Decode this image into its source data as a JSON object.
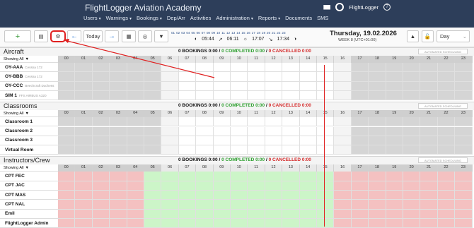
{
  "app": {
    "title": "FlightLogger Aviation Academy",
    "brand": "FlightLogger",
    "help_label": "?"
  },
  "nav": [
    "Users",
    "Warnings",
    "Bookings",
    "Dep/Arr",
    "Activities",
    "Administration",
    "Reports",
    "Documents",
    "SMS"
  ],
  "nav_carets": [
    true,
    true,
    true,
    false,
    false,
    true,
    true,
    false,
    false
  ],
  "toolbar": {
    "add_label": "+",
    "today_label": "Today",
    "view_label": "Day",
    "hour_labels": [
      "01",
      "02",
      "03",
      "04",
      "05",
      "06",
      "07",
      "08",
      "09",
      "10",
      "11",
      "12",
      "13",
      "14",
      "15",
      "16",
      "17",
      "18",
      "19",
      "20",
      "21",
      "22",
      "23"
    ],
    "sunrise": "05:44",
    "dawn": "06:11",
    "dusk": "17:07",
    "sunset": "17:34",
    "date_title": "Thursday, 19.02.2026",
    "date_sub": "WEEK 8 (UTC+01:00)"
  },
  "hours": [
    "00",
    "01",
    "02",
    "03",
    "04",
    "05",
    "06",
    "07",
    "08",
    "09",
    "10",
    "11",
    "12",
    "13",
    "14",
    "15",
    "16",
    "17",
    "18",
    "19",
    "20",
    "21",
    "22",
    "23"
  ],
  "counts": {
    "bookings": "0 BOOKINGS 0:00",
    "completed": "0 COMPLETED 0:00",
    "cancelled": "0 CANCELLED 0:00",
    "sep": "/"
  },
  "auto_label": "AUTOMATED SCHEDULING",
  "showing_label": "Showing All",
  "sections": [
    {
      "title": "Aircraft",
      "rows": [
        {
          "name": "OY-AAA",
          "sub": "Cessna 172"
        },
        {
          "name": "OY-BBB",
          "sub": "Cessna 172"
        },
        {
          "name": "OY-CCC",
          "sub": "Beechcraft Duchess"
        },
        {
          "name": "SIM 1",
          "sub": "FFS AIRBUS A320"
        }
      ]
    },
    {
      "title": "Classrooms",
      "rows": [
        {
          "name": "Classroom 1",
          "sub": ""
        },
        {
          "name": "Classroom 2",
          "sub": ""
        },
        {
          "name": "Classroom 3",
          "sub": ""
        },
        {
          "name": "Virtual Room",
          "sub": ""
        }
      ]
    },
    {
      "title": "Instructors/Crew",
      "rows": [
        {
          "name": "CPT FEC",
          "sub": ""
        },
        {
          "name": "CPT JAC",
          "sub": ""
        },
        {
          "name": "CPT MAS",
          "sub": ""
        },
        {
          "name": "CPT NAL",
          "sub": ""
        },
        {
          "name": "Emil",
          "sub": ""
        },
        {
          "name": "FlightLogger Admin",
          "sub": ""
        }
      ]
    }
  ],
  "colors": {
    "topbar": "#2d3e5a",
    "available": "#ccf5c8",
    "unavailable": "#f4c1c1",
    "now_line": "#e02020"
  }
}
